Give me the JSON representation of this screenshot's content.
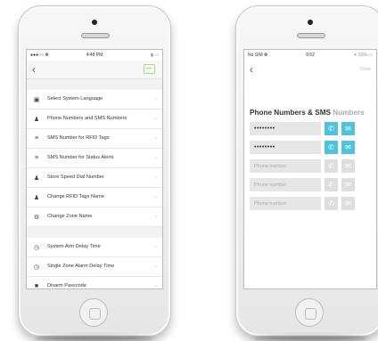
{
  "left_phone": {
    "status": {
      "carrier": "●●●○○ ❆",
      "time": "4:48 PM",
      "battery": "▮ ▭"
    },
    "nav": {
      "back_icon": "chevron-left-icon",
      "action_icon": "message-icon"
    },
    "group1": [
      {
        "icon": "language-icon",
        "glyph": "▣",
        "label": "Select System Language"
      },
      {
        "icon": "person-phone-icon",
        "glyph": "♟",
        "label": "Phone Numbers and SMS Numbers"
      },
      {
        "icon": "rfid-icon",
        "glyph": "≡",
        "label": "SMS Number for RFID Tags"
      },
      {
        "icon": "status-alert-icon",
        "glyph": "≡",
        "label": "SMS Number for Status Alerts"
      },
      {
        "icon": "speed-dial-icon",
        "glyph": "♟",
        "label": "Store Speed Dial Number"
      },
      {
        "icon": "person-icon",
        "glyph": "♟",
        "label": "Change RFID Tags Name"
      },
      {
        "icon": "zone-icon",
        "glyph": "⚙",
        "label": "Change Zone Name"
      }
    ],
    "group2": [
      {
        "icon": "clock-icon",
        "glyph": "◷",
        "label": "System Arm Delay Time"
      },
      {
        "icon": "clock-icon",
        "glyph": "◷",
        "label": "Single Zone Alarm Delay Time"
      },
      {
        "icon": "lock-icon",
        "glyph": "■",
        "label": "Disarm Passcode"
      }
    ],
    "chevron": "›"
  },
  "right_phone": {
    "status": {
      "carrier": "No SIM ❆",
      "time": "9:52",
      "battery": "✶ 31% ▭"
    },
    "nav": {
      "back": "‹",
      "done": "Done"
    },
    "title_main": "Phone Numbers & SMS",
    "title_suffix": "Numbers",
    "phone_rows": [
      {
        "value": "••••••••",
        "filled": true
      },
      {
        "value": "••••••••",
        "filled": true
      },
      {
        "placeholder": "Phone number",
        "filled": false
      },
      {
        "placeholder": "Phone number",
        "filled": false
      },
      {
        "placeholder": "Phone number",
        "filled": false
      }
    ],
    "call_glyph": "✆",
    "sms_glyph": "✉"
  },
  "colors": {
    "accent": "#4ec3de",
    "message_green": "#9be36d",
    "disabled": "#dedede"
  }
}
